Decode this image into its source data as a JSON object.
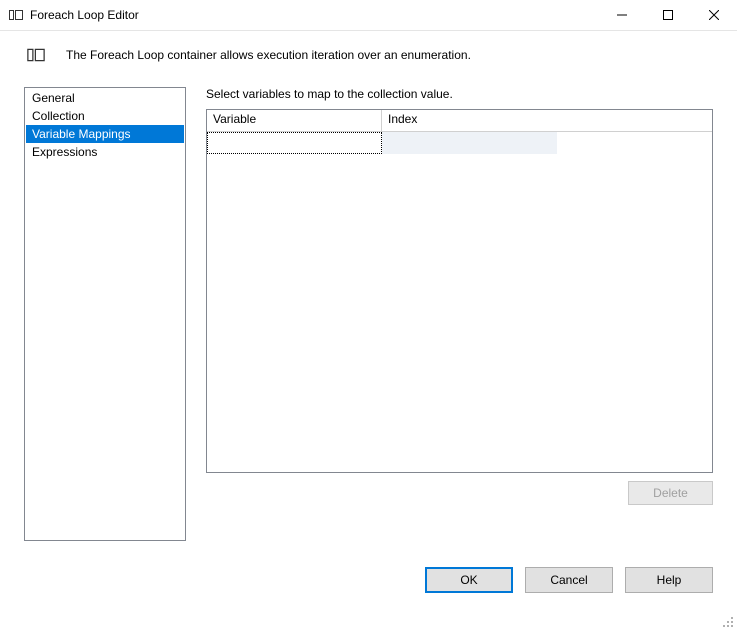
{
  "window": {
    "title": "Foreach Loop Editor"
  },
  "header": {
    "description": "The Foreach Loop container allows execution iteration over an enumeration."
  },
  "sidebar": {
    "items": [
      {
        "label": "General",
        "selected": false
      },
      {
        "label": "Collection",
        "selected": false
      },
      {
        "label": "Variable Mappings",
        "selected": true
      },
      {
        "label": "Expressions",
        "selected": false
      }
    ]
  },
  "main": {
    "instruction": "Select variables to map to the collection value.",
    "columns": {
      "variable": "Variable",
      "index": "Index"
    },
    "rows": [
      {
        "variable": "",
        "index": ""
      }
    ],
    "delete_label": "Delete",
    "delete_enabled": false
  },
  "footer": {
    "ok": "OK",
    "cancel": "Cancel",
    "help": "Help"
  }
}
